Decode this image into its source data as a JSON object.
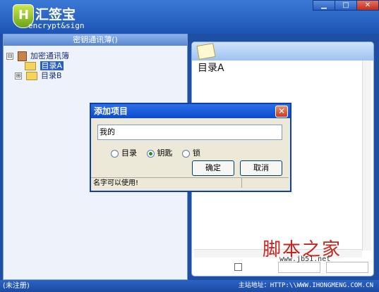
{
  "app": {
    "title": "汇签宝",
    "subtitle": "encrypt&sign",
    "logo_letter": "H",
    "window_buttons": [
      "▁",
      "□",
      "✕"
    ]
  },
  "left_panel": {
    "header": "密钥通讯薄()",
    "tree": [
      {
        "label": "加密通讯簿",
        "expander": "⊟",
        "icon": "book-icon"
      },
      {
        "label": "目录A",
        "icon": "folder-icon",
        "selected": true
      },
      {
        "label": "目录B",
        "expander": "⊞",
        "icon": "folder-icon"
      }
    ]
  },
  "right_panel": {
    "content_text": "目录A"
  },
  "dialog": {
    "title": "添加项目",
    "close_glyph": "✕",
    "input_value": "我的",
    "radios": [
      {
        "label": "目录",
        "checked": false
      },
      {
        "label": "钥匙",
        "checked": true
      },
      {
        "label": "锁",
        "checked": false
      }
    ],
    "ok_label": "确定",
    "cancel_label": "取消",
    "status_text": "名字可以使用!"
  },
  "watermark": {
    "text": "脚本之家",
    "url": "www.jb51.net"
  },
  "statusbar": {
    "left": "(未注册)",
    "right": "主站地址：HTTP:\\\\WWW.IHONGMENG.COM.CN"
  },
  "colors": {
    "accent": "#1e4fa3",
    "dialog_title": "#0a4ad0",
    "watermark": "#c9231b"
  }
}
